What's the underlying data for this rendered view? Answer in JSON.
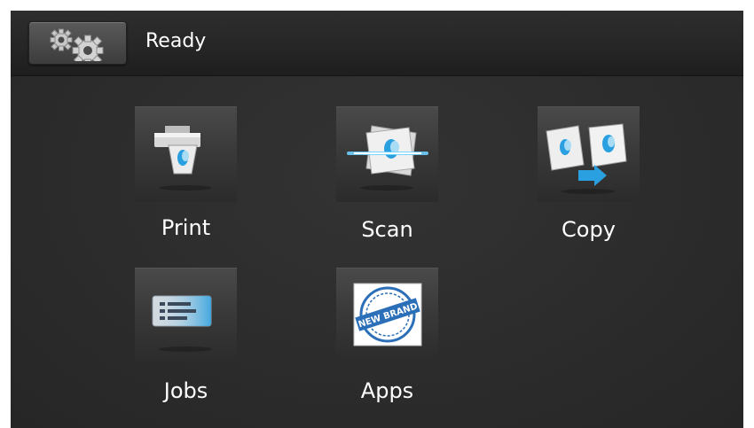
{
  "status_bar": {
    "status_text": "Ready",
    "settings_icon": "gears-icon"
  },
  "tiles": [
    {
      "label": "Print",
      "icon": "print-icon"
    },
    {
      "label": "Scan",
      "icon": "scan-icon"
    },
    {
      "label": "Copy",
      "icon": "copy-icon"
    },
    {
      "label": "Jobs",
      "icon": "jobs-icon"
    },
    {
      "label": "Apps",
      "icon": "apps-icon",
      "badge_text": "NEW BRAND"
    }
  ],
  "colors": {
    "background": "#2c2c2c",
    "text": "#ffffff",
    "accent_blue": "#2aa0e0"
  }
}
